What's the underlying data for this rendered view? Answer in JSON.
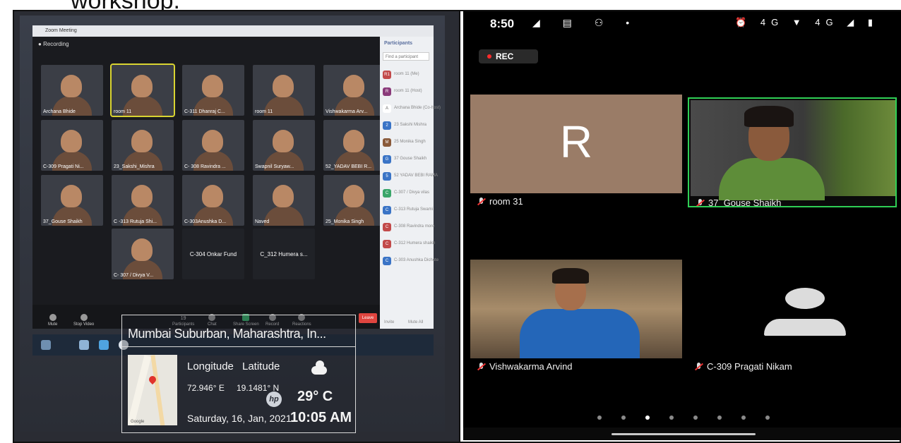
{
  "document": {
    "top_text": "workshop."
  },
  "left": {
    "zoom": {
      "window_title": "Zoom Meeting",
      "rec_label": "Recording",
      "panel_title": "Participants",
      "find_placeholder": "Find a participant",
      "tiles": [
        "Archana Bhide",
        "room 11",
        "C-311 Dhanraj C...",
        "room 11",
        "Vishwakarma Arv...",
        "C-309 Pragati Ni...",
        "23_Sakshi_Mishra",
        "C- 308 Ravindra ...",
        "Swapnil Suryaw...",
        "52_YADAV BEBI R...",
        "37_Gouse Shaikh",
        "C -313 Rutuja Shi...",
        "C-303Anushka D...",
        "Naved",
        "25_Monika Singh",
        "C- 307 / Divya V...",
        "C-304 Onkar Fund",
        "C_312 Humera s..."
      ],
      "participants": [
        {
          "initial": "R1",
          "name": "room 11 (Me)"
        },
        {
          "initial": "R",
          "name": "room 11 (Host)"
        },
        {
          "initial": "A",
          "name": "Archana Bhide (Co-host)"
        },
        {
          "initial": "2",
          "name": "23 Sakshi Mishra"
        },
        {
          "initial": "M",
          "name": "25 Monika Singh"
        },
        {
          "initial": "G",
          "name": "37 Gouse Shaikh"
        },
        {
          "initial": "5",
          "name": "52 YADAV BEBI RAMA"
        },
        {
          "initial": "C",
          "name": "C-307 / Divya vilas"
        },
        {
          "initial": "C",
          "name": "C-313 Rutuja Swami"
        },
        {
          "initial": "C",
          "name": "C-308 Ravindra more"
        },
        {
          "initial": "C",
          "name": "C-312 Humera shaikh"
        },
        {
          "initial": "C",
          "name": "C-303 Anushka Dichote"
        }
      ],
      "panel_footer": [
        "Invite",
        "Mute All"
      ],
      "toolbar": {
        "mute": "Mute",
        "video": "Stop Video",
        "participants_count": "19",
        "participants": "Participants",
        "chat": "Chat",
        "share": "Share Screen",
        "record": "Record",
        "reactions": "Reactions",
        "leave": "Leave"
      }
    },
    "stamp": {
      "location": "Mumbai Suburban, Maharashtra, In...",
      "lon_label": "Longitude",
      "lat_label": "Latitude",
      "lon": "72.946° E",
      "lat": "19.1481° N",
      "temp": "29° C",
      "date": "Saturday, 16, Jan, 2021",
      "time": "10:05 AM",
      "map_credit": "Google",
      "brand": "hp"
    }
  },
  "right": {
    "status": {
      "time": "8:50",
      "left_icons": "◢ ▤ ⚇ •",
      "right_icons": "⏰ 4G ▼ 4G ◢ ▮"
    },
    "rec_label": "REC",
    "tiles": [
      {
        "name": "room 31",
        "initial": "R"
      },
      {
        "name": "37_Gouse Shaikh"
      },
      {
        "name": "Vishwakarma Arvind"
      },
      {
        "name": "C-309 Pragati Nikam"
      }
    ],
    "pager": {
      "pages": 8,
      "active_index": 2
    },
    "colors": {
      "active_speaker": "#2fcf55",
      "rec_dot": "#ff2b2b",
      "avatar_tile": "#9a7c67"
    }
  }
}
